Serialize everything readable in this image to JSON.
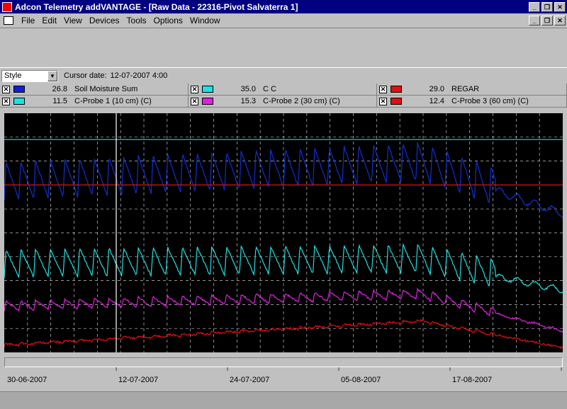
{
  "window": {
    "title": "Adcon Telemetry addVANTAGE - [Raw Data - 22316-Pivot Salvaterra 1]"
  },
  "menu": {
    "items": [
      "File",
      "Edit",
      "View",
      "Devices",
      "Tools",
      "Options",
      "Window"
    ]
  },
  "style_select": {
    "value": "Style"
  },
  "cursor": {
    "label": "Cursor date:",
    "value": "12-07-2007 4:00"
  },
  "legend": [
    {
      "name": "Soil Moisture Sum",
      "value": "26.8",
      "color": "#1020d0",
      "checked": true
    },
    {
      "name": "C C",
      "value": "35.0",
      "color": "#20e0e0",
      "checked": true
    },
    {
      "name": "REGAR",
      "value": "29.0",
      "color": "#e01010",
      "checked": true
    },
    {
      "name": "C-Probe 1 (10 cm) (C)",
      "value": "11.5",
      "color": "#20e0e0",
      "checked": true
    },
    {
      "name": "C-Probe 2 (30 cm) (C)",
      "value": "15.3",
      "color": "#e020e0",
      "checked": true
    },
    {
      "name": "C-Probe 3 (60 cm) (C)",
      "value": "12.4",
      "color": "#e01010",
      "checked": true
    }
  ],
  "chart_data": {
    "type": "line",
    "x_tick_labels": [
      "30-06-2007",
      "12-07-2007",
      "24-07-2007",
      "05-08-2007",
      "17-08-2007"
    ],
    "cursor_date": "12-07-2007 4:00",
    "grid": true,
    "background": "#000000",
    "series": [
      {
        "name": "Soil Moisture Sum",
        "color": "#1030d0",
        "level_start": 0.7,
        "level_mid": 0.78,
        "level_end": 0.58,
        "amplitude": 0.16,
        "cycles": 38,
        "peak_pos": 0.91
      },
      {
        "name": "C C",
        "color": "#20e0e0",
        "constant_level": 0.89
      },
      {
        "name": "REGAR",
        "color": "#e01010",
        "constant_level": 0.7
      },
      {
        "name": "C-Probe 1 (10 cm) (C)",
        "color": "#20e0e0",
        "level_start": 0.36,
        "level_mid": 0.38,
        "level_end": 0.26,
        "amplitude": 0.12,
        "cycles": 38,
        "peak_pos": 0.52
      },
      {
        "name": "C-Probe 2 (30 cm) (C)",
        "color": "#e020e0",
        "level_start": 0.19,
        "level_mid": 0.24,
        "level_end": 0.09,
        "amplitude": 0.04,
        "cycles": 38,
        "peak_pos": 0.25
      },
      {
        "name": "C-Probe 3 (60 cm) (C)",
        "color": "#e01010",
        "level_start": 0.03,
        "level_mid": 0.13,
        "level_end": 0.02,
        "amplitude": 0.01,
        "cycles": 38,
        "peak_pos": 0.14
      }
    ]
  }
}
